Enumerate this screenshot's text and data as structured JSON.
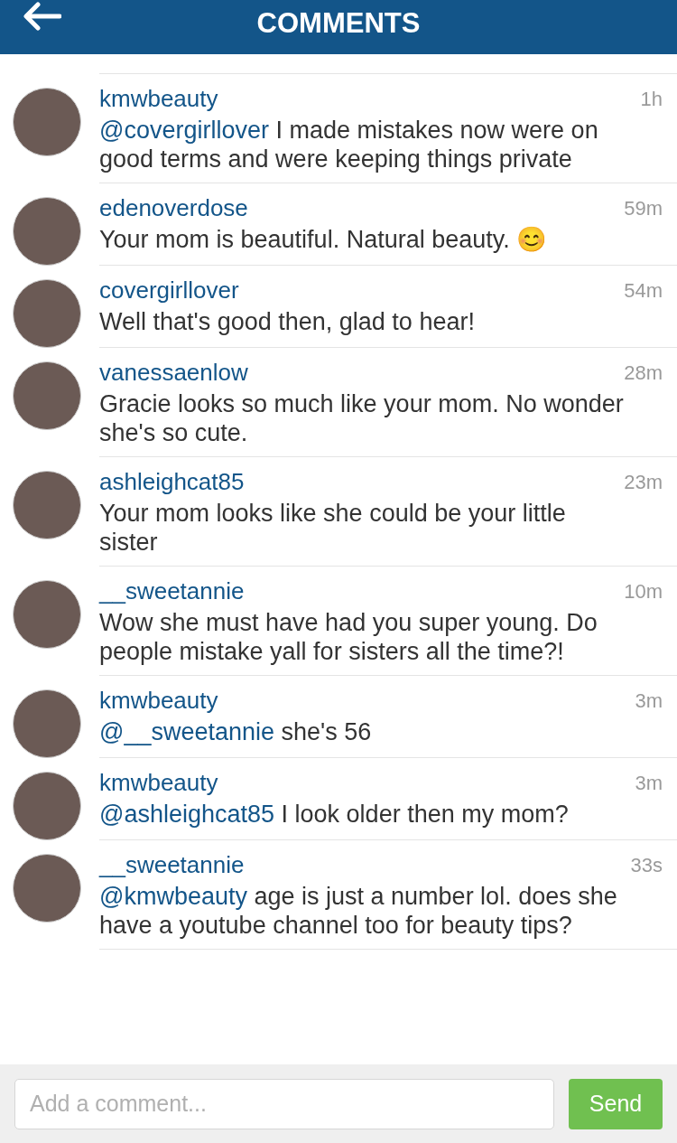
{
  "header": {
    "title": "COMMENTS"
  },
  "comments": [
    {
      "user": "kmwbeauty",
      "time": "1h",
      "mention": "@covergirllover",
      "text": "I made mistakes now were on good terms and were keeping things private"
    },
    {
      "user": "edenoverdose",
      "time": "59m",
      "text": "Your mom is beautiful. Natural beauty. 😊"
    },
    {
      "user": "covergirllover",
      "time": "54m",
      "text": "Well that's good then, glad to hear!"
    },
    {
      "user": "vanessaenlow",
      "time": "28m",
      "text": "Gracie looks so much like your mom. No wonder she's so cute."
    },
    {
      "user": "ashleighcat85",
      "time": "23m",
      "text": "Your mom looks like she could be your little sister"
    },
    {
      "user": "__sweetannie",
      "time": "10m",
      "text": "Wow she must have had you super young.  Do people mistake yall for sisters all the time?!"
    },
    {
      "user": "kmwbeauty",
      "time": "3m",
      "mention": "@__sweetannie",
      "text": "she's 56"
    },
    {
      "user": "kmwbeauty",
      "time": "3m",
      "mention": "@ashleighcat85",
      "text": "I look older then my mom?"
    },
    {
      "user": "__sweetannie",
      "time": "33s",
      "mention": "@kmwbeauty",
      "text": "age is just a number lol.  does she have a youtube channel too for beauty tips?"
    }
  ],
  "composer": {
    "placeholder": "Add a comment...",
    "button": "Send"
  }
}
